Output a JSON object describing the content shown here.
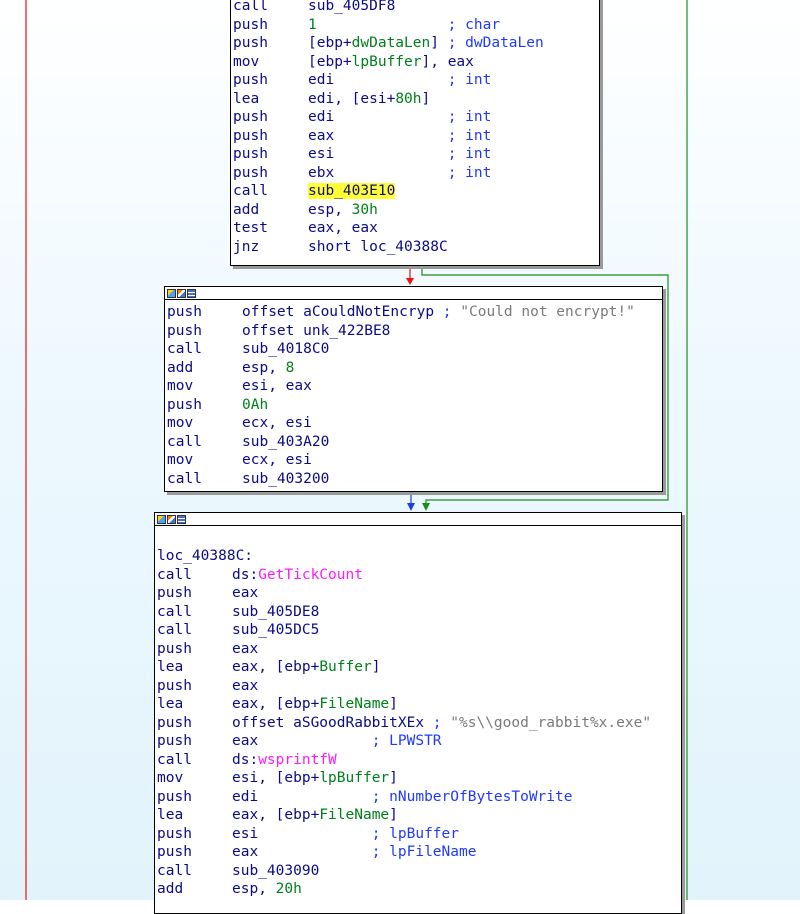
{
  "colors": {
    "edge_false": "#e11",
    "edge_true": "#1a8f1a",
    "edge_uncond": "#1b3fe0",
    "highlight": "#ffff33"
  },
  "node_a": [
    {
      "m": "call",
      "o": [
        {
          "t": "sub_405DF8"
        }
      ]
    },
    {
      "m": "push",
      "o": [
        {
          "t": "1",
          "c": "num"
        },
        {
          "t": "               ; char",
          "c": "cmt"
        }
      ]
    },
    {
      "m": "push",
      "o": [
        {
          "t": "[ebp+"
        },
        {
          "t": "dwDataLen",
          "c": "var"
        },
        {
          "t": "]"
        },
        {
          "t": " ; dwDataLen",
          "c": "cmt"
        }
      ]
    },
    {
      "m": "mov",
      "o": [
        {
          "t": "[ebp+"
        },
        {
          "t": "lpBuffer",
          "c": "var"
        },
        {
          "t": "], eax"
        }
      ]
    },
    {
      "m": "push",
      "o": [
        {
          "t": "edi"
        },
        {
          "t": "             ; int",
          "c": "cmt"
        }
      ]
    },
    {
      "m": "lea",
      "o": [
        {
          "t": "edi, [esi+"
        },
        {
          "t": "80h",
          "c": "num"
        },
        {
          "t": "]"
        }
      ]
    },
    {
      "m": "push",
      "o": [
        {
          "t": "edi"
        },
        {
          "t": "             ; int",
          "c": "cmt"
        }
      ]
    },
    {
      "m": "push",
      "o": [
        {
          "t": "eax"
        },
        {
          "t": "             ; int",
          "c": "cmt"
        }
      ]
    },
    {
      "m": "push",
      "o": [
        {
          "t": "esi"
        },
        {
          "t": "             ; int",
          "c": "cmt"
        }
      ]
    },
    {
      "m": "push",
      "o": [
        {
          "t": "ebx"
        },
        {
          "t": "             ; int",
          "c": "cmt"
        }
      ]
    },
    {
      "m": "call",
      "o": [
        {
          "t": "sub_403E10",
          "c": "hl"
        }
      ]
    },
    {
      "m": "add",
      "o": [
        {
          "t": "esp, "
        },
        {
          "t": "30h",
          "c": "num"
        }
      ]
    },
    {
      "m": "test",
      "o": [
        {
          "t": "eax, eax"
        }
      ]
    },
    {
      "m": "jnz",
      "o": [
        {
          "t": "short loc_40388C"
        }
      ]
    }
  ],
  "node_b": [
    {
      "m": "push",
      "o": [
        {
          "t": "offset aCouldNotEncryp"
        },
        {
          "t": " ; ",
          "c": "cmt"
        },
        {
          "t": "\"Could not encrypt!\"",
          "c": "strc"
        }
      ]
    },
    {
      "m": "push",
      "o": [
        {
          "t": "offset unk_422BE8"
        }
      ]
    },
    {
      "m": "call",
      "o": [
        {
          "t": "sub_4018C0"
        }
      ]
    },
    {
      "m": "add",
      "o": [
        {
          "t": "esp, "
        },
        {
          "t": "8",
          "c": "num"
        }
      ]
    },
    {
      "m": "mov",
      "o": [
        {
          "t": "esi, eax"
        }
      ]
    },
    {
      "m": "push",
      "o": [
        {
          "t": "0Ah",
          "c": "num"
        }
      ]
    },
    {
      "m": "mov",
      "o": [
        {
          "t": "ecx, esi"
        }
      ]
    },
    {
      "m": "call",
      "o": [
        {
          "t": "sub_403A20"
        }
      ]
    },
    {
      "m": "mov",
      "o": [
        {
          "t": "ecx, esi"
        }
      ]
    },
    {
      "m": "call",
      "o": [
        {
          "t": "sub_403200"
        }
      ]
    }
  ],
  "node_c_label": "loc_40388C:",
  "node_c": [
    {
      "m": "call",
      "o": [
        {
          "t": "ds:"
        },
        {
          "t": "GetTickCount",
          "c": "api"
        }
      ]
    },
    {
      "m": "push",
      "o": [
        {
          "t": "eax"
        }
      ]
    },
    {
      "m": "call",
      "o": [
        {
          "t": "sub_405DE8"
        }
      ]
    },
    {
      "m": "call",
      "o": [
        {
          "t": "sub_405DC5"
        }
      ]
    },
    {
      "m": "push",
      "o": [
        {
          "t": "eax"
        }
      ]
    },
    {
      "m": "lea",
      "o": [
        {
          "t": "eax, [ebp+"
        },
        {
          "t": "Buffer",
          "c": "var"
        },
        {
          "t": "]"
        }
      ]
    },
    {
      "m": "push",
      "o": [
        {
          "t": "eax"
        }
      ]
    },
    {
      "m": "lea",
      "o": [
        {
          "t": "eax, [ebp+"
        },
        {
          "t": "FileName",
          "c": "var"
        },
        {
          "t": "]"
        }
      ]
    },
    {
      "m": "push",
      "o": [
        {
          "t": "offset aSGoodRabbitXEx"
        },
        {
          "t": " ; ",
          "c": "cmt"
        },
        {
          "t": "\"%s\\\\good_rabbit%x.exe\"",
          "c": "strc"
        }
      ]
    },
    {
      "m": "push",
      "o": [
        {
          "t": "eax"
        },
        {
          "t": "             ; LPWSTR",
          "c": "cmt"
        }
      ]
    },
    {
      "m": "call",
      "o": [
        {
          "t": "ds:"
        },
        {
          "t": "wsprintfW",
          "c": "api"
        }
      ]
    },
    {
      "m": "mov",
      "o": [
        {
          "t": "esi, [ebp+"
        },
        {
          "t": "lpBuffer",
          "c": "var"
        },
        {
          "t": "]"
        }
      ]
    },
    {
      "m": "push",
      "o": [
        {
          "t": "edi"
        },
        {
          "t": "             ; nNumberOfBytesToWrite",
          "c": "cmt"
        }
      ]
    },
    {
      "m": "lea",
      "o": [
        {
          "t": "eax, [ebp+"
        },
        {
          "t": "FileName",
          "c": "var"
        },
        {
          "t": "]"
        }
      ]
    },
    {
      "m": "push",
      "o": [
        {
          "t": "esi"
        },
        {
          "t": "             ; lpBuffer",
          "c": "cmt"
        }
      ]
    },
    {
      "m": "push",
      "o": [
        {
          "t": "eax"
        },
        {
          "t": "             ; lpFileName",
          "c": "cmt"
        }
      ]
    },
    {
      "m": "call",
      "o": [
        {
          "t": "sub_403090"
        }
      ]
    },
    {
      "m": "add",
      "o": [
        {
          "t": "esp, "
        },
        {
          "t": "20h",
          "c": "num"
        }
      ]
    }
  ]
}
